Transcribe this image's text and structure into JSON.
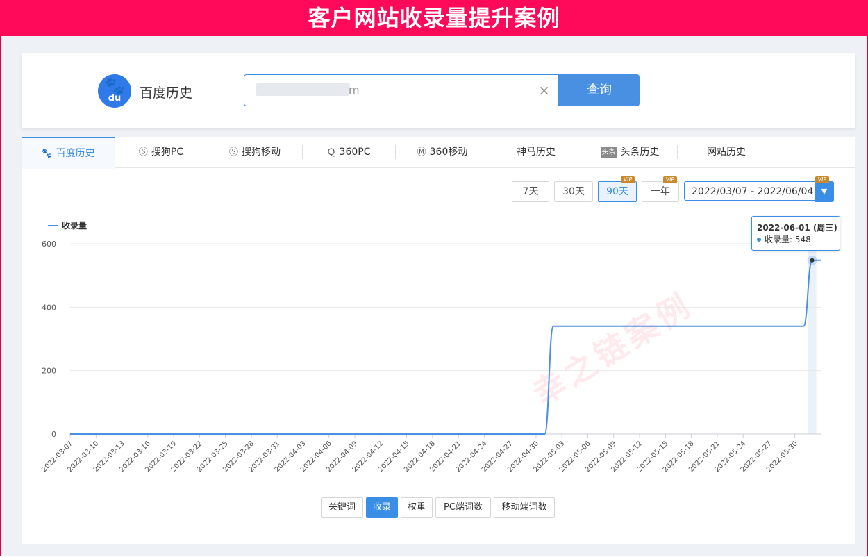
{
  "banner": {
    "title": "客户网站收录量提升案例"
  },
  "search": {
    "engine_label": "百度历史",
    "logo_text": "du",
    "query_value": "m",
    "submit_label": "查询"
  },
  "tabs": [
    {
      "label": "百度历史",
      "icon": "paw-icon",
      "icon_glyph": "🐾"
    },
    {
      "label": "搜狗PC",
      "icon": "sogou-icon",
      "icon_glyph": "Ⓢ"
    },
    {
      "label": "搜狗移动",
      "icon": "sogou-icon",
      "icon_glyph": "Ⓢ"
    },
    {
      "label": "360PC",
      "icon": "q360-icon",
      "icon_glyph": "Ｑ"
    },
    {
      "label": "360移动",
      "icon": "m360-icon",
      "icon_glyph": "Ⓜ"
    },
    {
      "label": "神马历史",
      "icon": "",
      "icon_glyph": ""
    },
    {
      "label": "头条历史",
      "icon": "toutiao-icon",
      "icon_glyph": "头条"
    },
    {
      "label": "网站历史",
      "icon": "",
      "icon_glyph": ""
    }
  ],
  "ranges": [
    {
      "label": "7天",
      "vip": ""
    },
    {
      "label": "30天",
      "vip": ""
    },
    {
      "label": "90天",
      "vip": "VIP"
    },
    {
      "label": "一年",
      "vip": "VIP"
    }
  ],
  "date_range": {
    "value": "2022/03/07 - 2022/06/04",
    "vip": "VIP"
  },
  "metrics": [
    {
      "label": "关键词"
    },
    {
      "label": "收录"
    },
    {
      "label": "权重"
    },
    {
      "label": "PC端词数"
    },
    {
      "label": "移动端词数"
    }
  ],
  "tooltip": {
    "title": "2022-06-01 (周三)",
    "row": "收录量: 548"
  },
  "watermark": "幸之链案例",
  "colors": {
    "accent": "#3a8ee6",
    "line": "#4a90e2",
    "banner": "#ff0a5a"
  },
  "chart_data": {
    "type": "line",
    "series": [
      {
        "name": "收录量",
        "points": [
          [
            "2022-03-07",
            0
          ],
          [
            "2022-04-30",
            0
          ],
          [
            "2022-05-01",
            0
          ],
          [
            "2022-05-02",
            340
          ],
          [
            "2022-05-30",
            340
          ],
          [
            "2022-05-31",
            340
          ],
          [
            "2022-06-01",
            548
          ],
          [
            "2022-06-02",
            548
          ]
        ]
      }
    ],
    "x_ticks": [
      "2022-03-07",
      "2022-03-10",
      "2022-03-13",
      "2022-03-16",
      "2022-03-19",
      "2022-03-22",
      "2022-03-25",
      "2022-03-28",
      "2022-03-31",
      "2022-04-03",
      "2022-04-06",
      "2022-04-09",
      "2022-04-12",
      "2022-04-15",
      "2022-04-18",
      "2022-04-21",
      "2022-04-24",
      "2022-04-27",
      "2022-04-30",
      "2022-05-03",
      "2022-05-06",
      "2022-05-09",
      "2022-05-12",
      "2022-05-15",
      "2022-05-18",
      "2022-05-21",
      "2022-05-24",
      "2022-05-27",
      "2022-05-30"
    ],
    "y_ticks": [
      0,
      200,
      400,
      600
    ],
    "ylim": [
      0,
      600
    ],
    "xlim": [
      "2022-03-07",
      "2022-06-02"
    ],
    "highlight": {
      "x": "2022-06-01",
      "y": 548
    },
    "grid": true,
    "legend": "top-left"
  }
}
